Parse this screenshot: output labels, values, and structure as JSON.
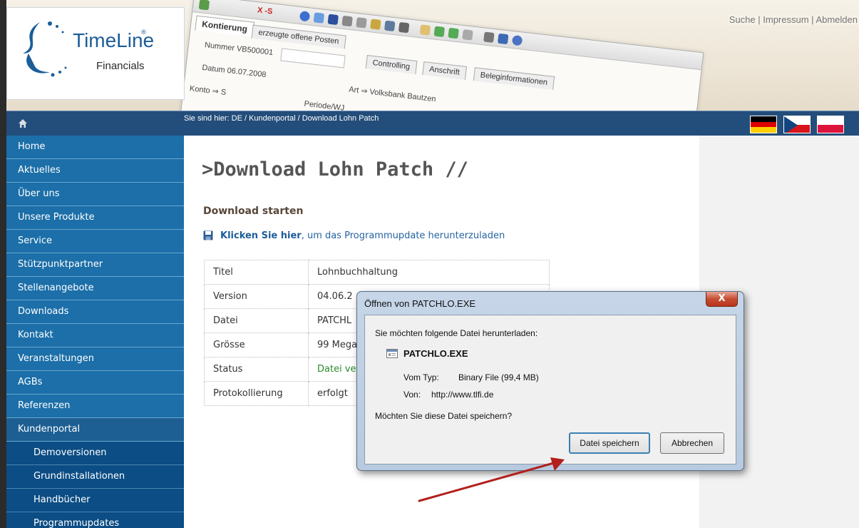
{
  "header": {
    "logo": {
      "title": "TimeLine",
      "reg": "®",
      "subtitle": "Financials"
    },
    "top_links": {
      "search": "Suche",
      "sep1": " | ",
      "imprint": "Impressum",
      "sep2": " | ",
      "logout": "Abmelden"
    },
    "app_screenshot": {
      "tabs": [
        "Kontierung",
        "erzeugte offene Posten",
        "Controlling",
        "Anschrift",
        "Beleginformationen"
      ],
      "fields": [
        "Nummer VB500001",
        "Datum 06.07.2008",
        "Konto ⇒ S",
        "Art ⇒ Volksbank Bautzen",
        "Periode/WJ"
      ],
      "toolbar_text": "X -S"
    }
  },
  "navbar": {
    "breadcrumb": "Sie sind hier: DE / Kundenportal / Download Lohn Patch",
    "flags": [
      "de",
      "cz",
      "pl"
    ],
    "home_icon": "home-icon"
  },
  "sidebar": {
    "items": [
      {
        "label": "Home"
      },
      {
        "label": "Aktuelles"
      },
      {
        "label": "Über uns"
      },
      {
        "label": "Unsere Produkte"
      },
      {
        "label": "Service"
      },
      {
        "label": "Stützpunktpartner"
      },
      {
        "label": "Stellenangebote"
      },
      {
        "label": "Downloads"
      },
      {
        "label": "Kontakt"
      },
      {
        "label": "Veranstaltungen"
      },
      {
        "label": "AGBs"
      },
      {
        "label": "Referenzen"
      },
      {
        "label": "Kundenportal"
      }
    ],
    "subitems": [
      {
        "label": "Demoversionen"
      },
      {
        "label": "Grundinstallationen"
      },
      {
        "label": "Handbücher"
      },
      {
        "label": "Programmupdates"
      }
    ]
  },
  "main": {
    "title": ">Download Lohn Patch //",
    "section_title": "Download starten",
    "download_link": "Klicken Sie hier",
    "download_rest": ", um das Programmupdate herunterzuladen",
    "table": [
      {
        "key": "Titel",
        "value": "Lohnbuchhaltung"
      },
      {
        "key": "Version",
        "value": "04.06.2"
      },
      {
        "key": "Datei",
        "value": "PATCHL"
      },
      {
        "key": "Grösse",
        "value": "99 Mega"
      },
      {
        "key": "Status",
        "value": "Datei ve"
      },
      {
        "key": "Protokollierung",
        "value": "erfolgt"
      }
    ]
  },
  "dialog": {
    "title": "Öffnen von PATCHLO.EXE",
    "close": "X",
    "question": "Sie möchten folgende Datei herunterladen:",
    "filename": "PATCHLO.EXE",
    "type_label": "Vom Typ:",
    "type_value": "Binary File (99,4 MB)",
    "from_label": "Von:",
    "from_value": "http://www.tlfi.de",
    "save_question": "Möchten Sie diese Datei speichern?",
    "save_button": "Datei speichern",
    "cancel_button": "Abbrechen"
  },
  "colors": {
    "navbar": "#234d7a",
    "sidebar": "#1c6fa8",
    "sidebar_sub": "#0b4d84",
    "link": "#1e5c98",
    "status_green": "#2a8c2a",
    "arrow": "#b3201c"
  }
}
